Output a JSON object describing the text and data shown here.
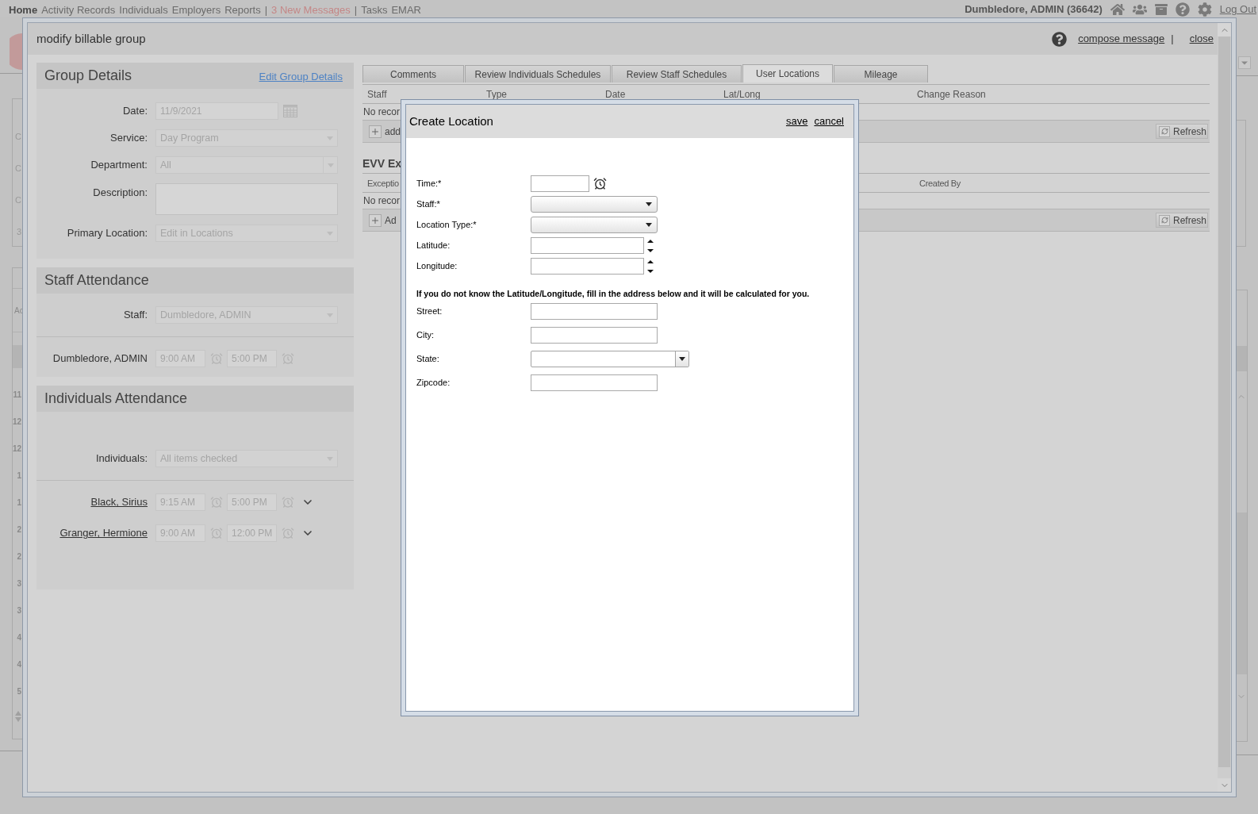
{
  "top_nav": {
    "items": [
      {
        "kind": "link",
        "label": "Home",
        "selected": true
      },
      {
        "kind": "link",
        "label": "Activity Records",
        "selected": false
      },
      {
        "kind": "link",
        "label": "Individuals",
        "selected": false
      },
      {
        "kind": "link",
        "label": "Employers",
        "selected": false
      },
      {
        "kind": "link",
        "label": "Reports",
        "selected": false
      },
      {
        "kind": "separator",
        "label": "|"
      },
      {
        "kind": "alert",
        "label": "3 New Messages"
      },
      {
        "kind": "separator",
        "label": "|"
      },
      {
        "kind": "link",
        "label": "Tasks",
        "selected": false
      },
      {
        "kind": "link",
        "label": "EMAR",
        "selected": false
      }
    ],
    "user": "Dumbledore, ADMIN (36642)",
    "logout": "Log Out"
  },
  "background_page": {
    "upper_box": [
      "C",
      "C",
      "C",
      "3"
    ],
    "lower_box": {
      "header": "Ac",
      "rows": [
        "11",
        "12",
        "12",
        "1",
        "1",
        "2",
        "2",
        "3",
        "3",
        "4",
        "4",
        "5"
      ]
    }
  },
  "modal": {
    "title": "modify billable group",
    "compose": "compose message",
    "separator": "|",
    "close": "close"
  },
  "group_details": {
    "title": "Group Details",
    "edit_link": "Edit Group Details",
    "fields": [
      {
        "kind": "date",
        "label": "Date:",
        "value": "11/9/2021"
      },
      {
        "kind": "select",
        "label": "Service:",
        "value": "Day Program"
      },
      {
        "kind": "split-select",
        "label": "Department:",
        "value": "All"
      },
      {
        "kind": "textarea",
        "label": "Description:"
      },
      {
        "kind": "select",
        "label": "Primary Location:",
        "value": "Edit in Locations"
      }
    ]
  },
  "staff_attendance": {
    "title": "Staff Attendance",
    "field": {
      "label": "Staff:",
      "value": "Dumbledore, ADMIN"
    },
    "rows": [
      {
        "name": "Dumbledore, ADMIN",
        "start": "9:00 AM",
        "end": "5:00 PM"
      }
    ]
  },
  "individuals_attendance": {
    "title": "Individuals Attendance",
    "field": {
      "label": "Individuals:",
      "value": "All items checked"
    },
    "rows": [
      {
        "name": "Black, Sirius",
        "start": "9:15 AM",
        "end": "5:00 PM"
      },
      {
        "name": "Granger, Hermione",
        "start": "9:00 AM",
        "end": "12:00 PM"
      }
    ]
  },
  "tabs": [
    {
      "label": "Comments",
      "selected": false
    },
    {
      "label": "Review Individuals Schedules",
      "selected": false
    },
    {
      "label": "Review Staff Schedules",
      "selected": false
    },
    {
      "label": "User Locations",
      "selected": true
    },
    {
      "label": "Mileage",
      "selected": false
    }
  ],
  "locations_table": {
    "columns": [
      "Staff",
      "Type",
      "Date",
      "Lat/Long",
      "Change Reason"
    ],
    "empty_text": "No recor",
    "add_label": "add",
    "refresh_label": "Refresh"
  },
  "evv_section": {
    "title": "EVV Ex",
    "columns": [
      "Exceptio",
      "Created By"
    ],
    "empty_text": "No recor",
    "add_label": "Ad",
    "refresh_label": "Refresh"
  },
  "dialog": {
    "title": "Create Location",
    "actions": [
      "save",
      "cancel"
    ],
    "fields": [
      {
        "kind": "time",
        "label": "Time:*"
      },
      {
        "kind": "select",
        "label": "Staff:*"
      },
      {
        "kind": "select",
        "label": "Location Type:*"
      },
      {
        "kind": "number",
        "label": "Latitude:"
      },
      {
        "kind": "number",
        "label": "Longitude:"
      },
      {
        "kind": "note",
        "label": "If you do not know the Latitude/Longitude, fill in the address below and it will be calculated for you."
      },
      {
        "kind": "text",
        "label": "Street:"
      },
      {
        "kind": "text",
        "label": "City:"
      },
      {
        "kind": "state-select",
        "label": "State:"
      },
      {
        "kind": "text",
        "label": "Zipcode:"
      }
    ]
  }
}
